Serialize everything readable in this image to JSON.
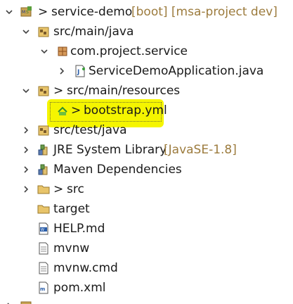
{
  "explorer": {
    "project": {
      "prefix": "> ",
      "name": "service-demo",
      "decoration": "[boot] [msa-project dev]"
    },
    "items": [
      {
        "label": "src/main/java"
      },
      {
        "label": "com.project.service"
      },
      {
        "label": "ServiceDemoApplication.java"
      },
      {
        "prefix": "> ",
        "label": "src/main/resources"
      },
      {
        "prefix": "> ",
        "label": "bootstrap.yml"
      },
      {
        "label": "src/test/java"
      },
      {
        "label": "JRE System Library",
        "decoration": "[JavaSE-1.8]"
      },
      {
        "label": "Maven Dependencies"
      },
      {
        "prefix": "> ",
        "label": "src"
      },
      {
        "label": "target"
      },
      {
        "label": "HELP.md"
      },
      {
        "label": "mvnw"
      },
      {
        "label": "mvnw.cmd"
      },
      {
        "label": "pom.xml"
      }
    ]
  },
  "colors": {
    "highlight": "#f5f500",
    "decoration": "#9c7b3d",
    "folder": "#e8c46a"
  }
}
